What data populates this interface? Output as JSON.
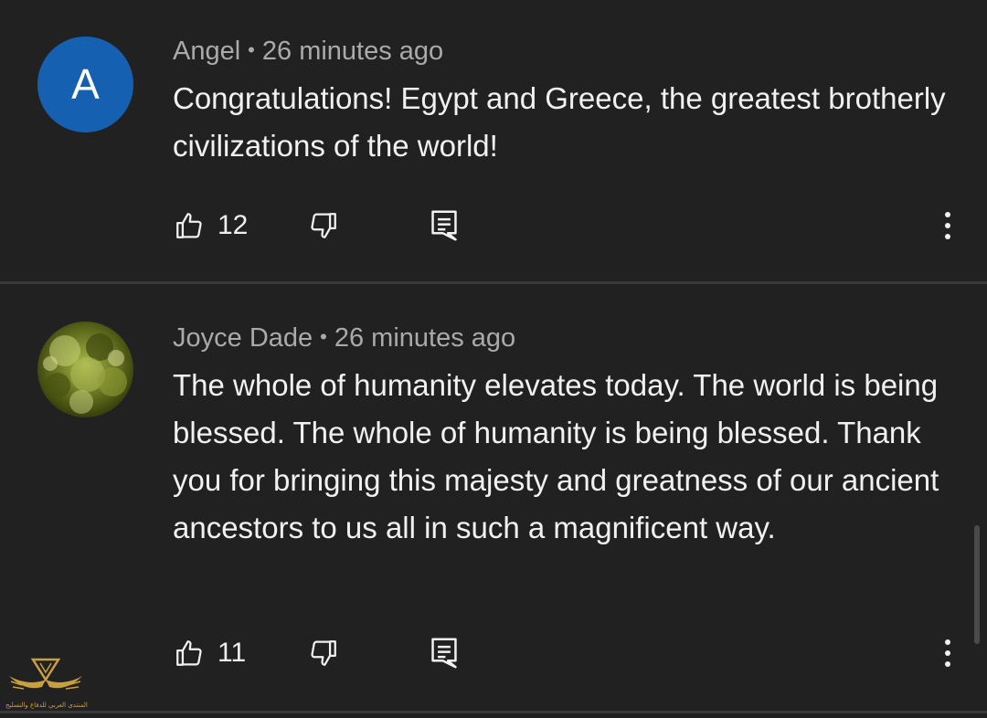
{
  "comments": [
    {
      "author": "Angel",
      "separator": "•",
      "time": "26 minutes ago",
      "avatar_letter": "A",
      "avatar_color": "#1560b0",
      "text": "Congratulations! Egypt and Greece, the greatest brotherly civilizations of the world!",
      "likes": "12",
      "icons": [
        "thumbs-up-icon",
        "thumbs-down-icon",
        "reply-icon",
        "more-vert-icon"
      ]
    },
    {
      "author": "Joyce Dade",
      "separator": "•",
      "time": "26 minutes ago",
      "avatar_color": "#6b7a20",
      "text": "The whole of humanity elevates today. The world is being blessed. The whole of humanity is being blessed. Thank you for bringing this majesty and greatness of our ancient ancestors to us all in such a magnificent way.",
      "likes": "11",
      "icons": [
        "thumbs-up-icon",
        "thumbs-down-icon",
        "reply-icon",
        "more-vert-icon"
      ]
    }
  ],
  "watermark": {
    "text": "المنتدى العربي للدفاع والتسليح",
    "color": "#c8a040"
  },
  "theme": {
    "background": "#212121",
    "text_primary": "#f1f1f1",
    "text_secondary": "#aaaaaa"
  }
}
